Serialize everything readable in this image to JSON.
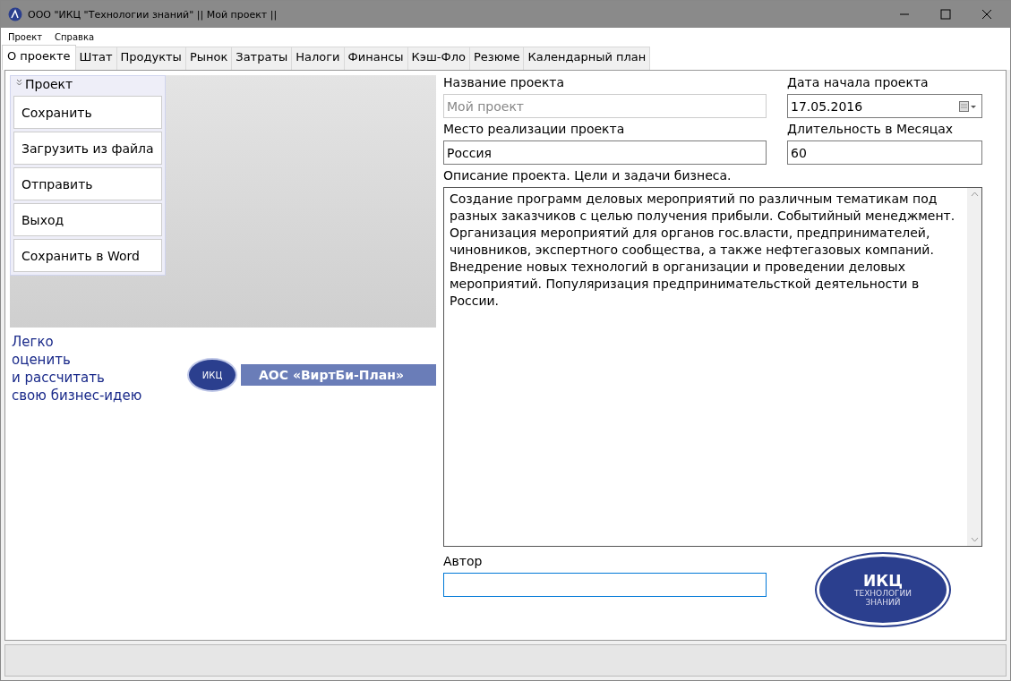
{
  "window": {
    "title": "ООО \"ИКЦ \"Технологии знаний\" || Мой проект ||"
  },
  "menu": [
    "Проект",
    "Справка"
  ],
  "tabs": [
    {
      "label": "О проекте",
      "selected": true
    },
    {
      "label": "Штат",
      "selected": false
    },
    {
      "label": "Продукты",
      "selected": false
    },
    {
      "label": "Рынок",
      "selected": false
    },
    {
      "label": "Затраты",
      "selected": false
    },
    {
      "label": "Налоги",
      "selected": false
    },
    {
      "label": "Финансы",
      "selected": false
    },
    {
      "label": "Кэш-Фло",
      "selected": false
    },
    {
      "label": "Резюме",
      "selected": false
    },
    {
      "label": "Календарный план",
      "selected": false
    }
  ],
  "project_panel": {
    "title": "Проект",
    "expanded": true,
    "buttons": [
      "Сохранить",
      "Загрузить из файла",
      "Отправить",
      "Выход",
      "Сохранить в Word"
    ]
  },
  "banner": {
    "slogan": [
      "Легко",
      "оценить",
      "и рассчитать",
      "свою бизнес-идею"
    ],
    "logo_text": "ИКЦ",
    "product": "АОС «ВиртБи-План»"
  },
  "form": {
    "name_label": "Название проекта",
    "name_placeholder": "Мой проект",
    "start_label": "Дата начала проекта",
    "start_value": "17.05.2016",
    "place_label": "Место реализации проекта",
    "place_value": "Россия",
    "duration_label": "Длительность в Месяцах",
    "duration_value": "60",
    "description_label": "Описание проекта. Цели и задачи бизнеса.",
    "description_value": "Создание программ деловых мероприятий по различным тематикам под разных заказчиков с целью получения прибыли. Событийный менеджмент. Организация мероприятий для органов гос.власти, предпринимателей, чиновников, экспертного сообщества, а также нефтегазовых компаний. Внедрение новых технологий в организации и проведении деловых мероприятий. Популяризация предпринимательсткой деятельности в России.",
    "author_label": "Автор"
  },
  "logo": {
    "title": "ИКЦ",
    "subtitle": [
      "ТЕХНОЛОГИИ",
      "ЗНАНИЙ"
    ]
  }
}
